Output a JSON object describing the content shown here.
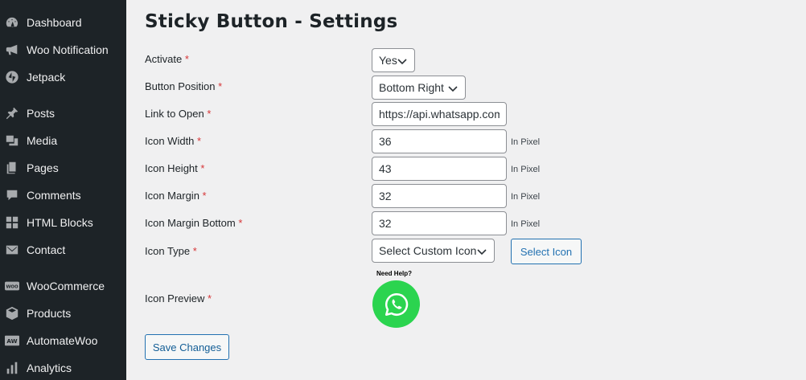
{
  "sidebar": {
    "items": [
      {
        "label": "Dashboard",
        "icon": "dashboard-icon"
      },
      {
        "label": "Woo Notification",
        "icon": "megaphone-icon"
      },
      {
        "label": "Jetpack",
        "icon": "jetpack-icon"
      },
      {
        "label": "Posts",
        "icon": "pushpin-icon"
      },
      {
        "label": "Media",
        "icon": "media-icon"
      },
      {
        "label": "Pages",
        "icon": "pages-icon"
      },
      {
        "label": "Comments",
        "icon": "comments-icon"
      },
      {
        "label": "HTML Blocks",
        "icon": "blocks-icon"
      },
      {
        "label": "Contact",
        "icon": "mail-icon"
      },
      {
        "label": "WooCommerce",
        "icon": "woo-icon"
      },
      {
        "label": "Products",
        "icon": "box-icon"
      },
      {
        "label": "AutomateWoo",
        "icon": "aw-icon"
      },
      {
        "label": "Analytics",
        "icon": "analytics-icon"
      }
    ],
    "woo_badge": "WOO",
    "aw_badge": "AW"
  },
  "page": {
    "title": "Sticky Button - Settings"
  },
  "form": {
    "required_mark": "*",
    "activate": {
      "label": "Activate",
      "value": "Yes"
    },
    "button_position": {
      "label": "Button Position",
      "value": "Bottom Right"
    },
    "link_to_open": {
      "label": "Link to Open",
      "value": "https://api.whatsapp.com"
    },
    "icon_width": {
      "label": "Icon Width",
      "value": "36",
      "unit": "In Pixel"
    },
    "icon_height": {
      "label": "Icon Height",
      "value": "43",
      "unit": "In Pixel"
    },
    "icon_margin": {
      "label": "Icon Margin",
      "value": "32",
      "unit": "In Pixel"
    },
    "icon_margin_bottom": {
      "label": "Icon Margin Bottom",
      "value": "32",
      "unit": "In Pixel"
    },
    "icon_type": {
      "label": "Icon Type",
      "value": "Select Custom Icon",
      "button": "Select Icon"
    },
    "icon_preview": {
      "label": "Icon Preview",
      "caption": "Need Help?",
      "icon": "whatsapp-icon"
    },
    "save_label": "Save Changes"
  },
  "colors": {
    "sidebar_bg": "#1d2327",
    "page_bg": "#f0f0f1",
    "accent": "#2271b1",
    "required": "#d63638",
    "whatsapp": "#2bd44f"
  }
}
